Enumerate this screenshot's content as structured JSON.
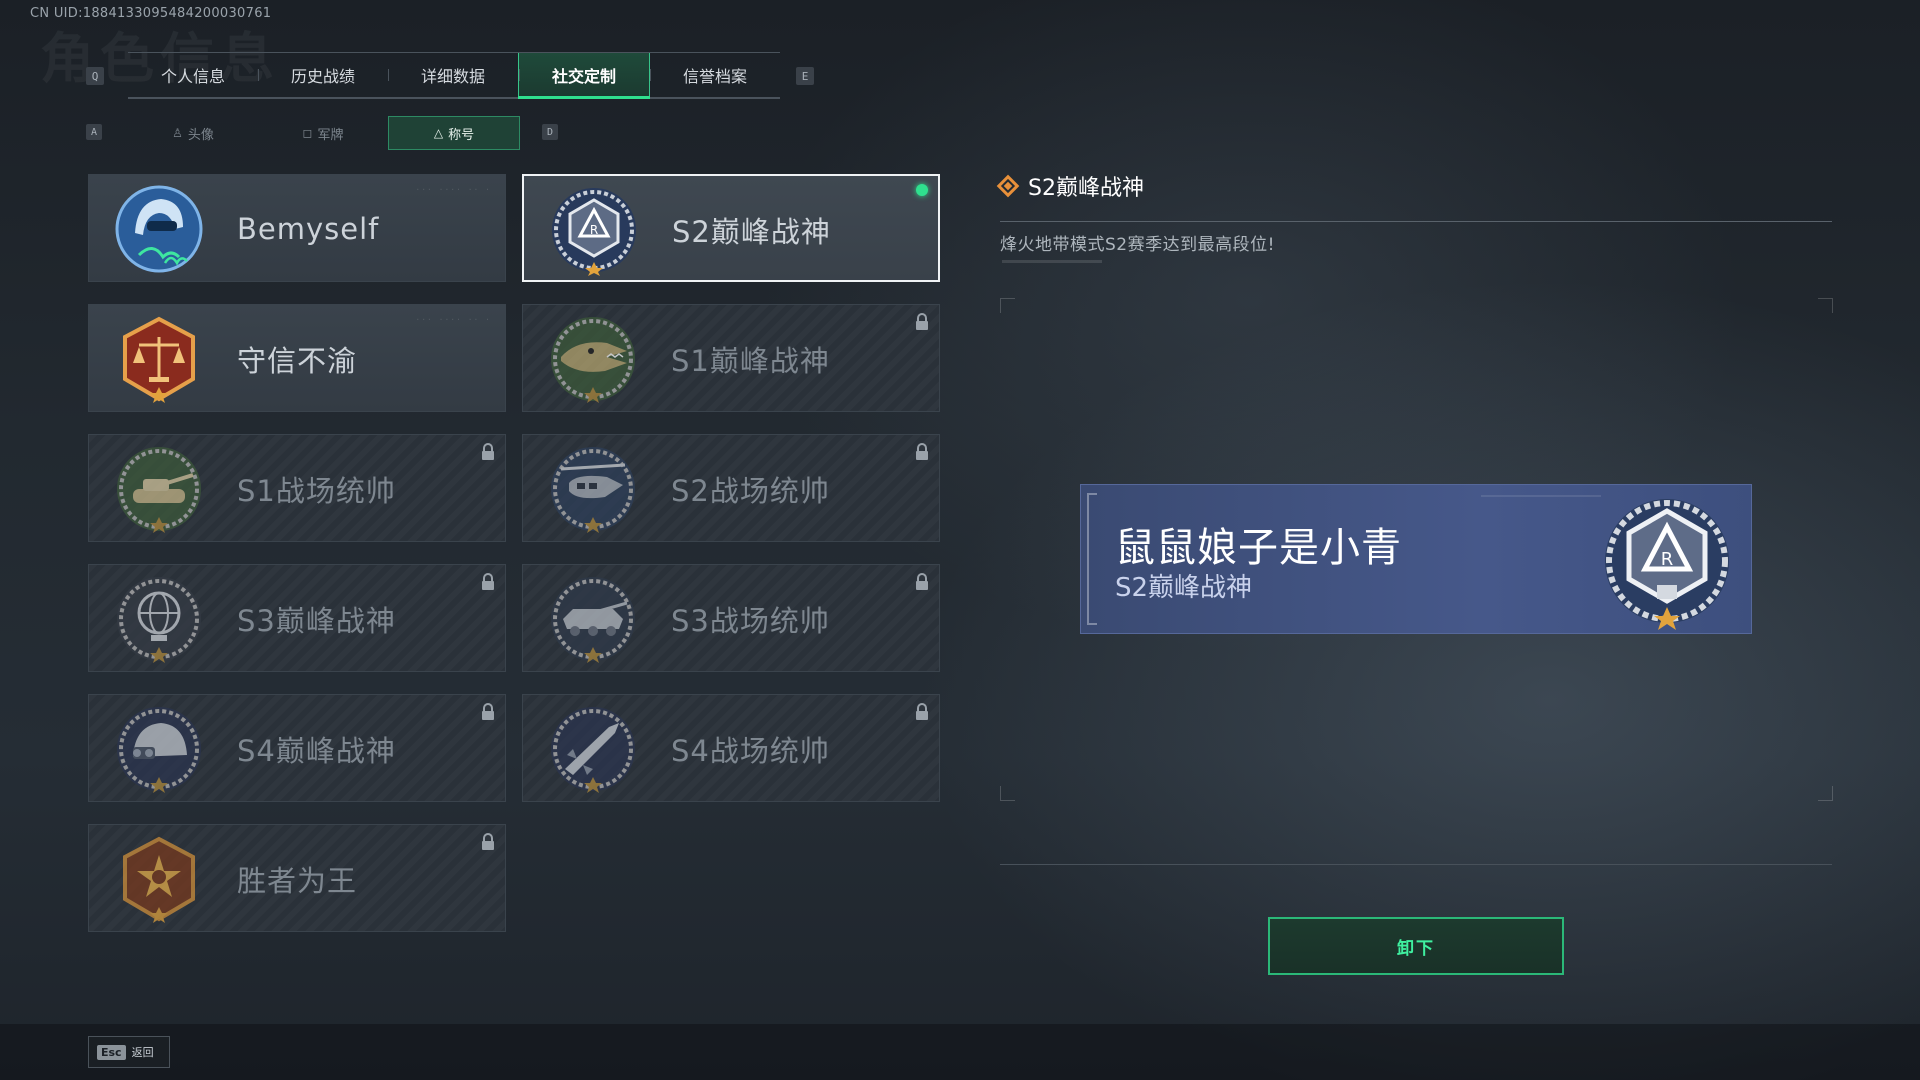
{
  "uid": "CN UID:1884133095484200030761",
  "ghost_title": "角色信息",
  "main_tabs": {
    "prev_key": "Q",
    "next_key": "E",
    "items": [
      {
        "label": "个人信息"
      },
      {
        "label": "历史战绩"
      },
      {
        "label": "详细数据"
      },
      {
        "label": "社交定制",
        "active": true
      },
      {
        "label": "信誉档案"
      }
    ]
  },
  "sub_tabs": {
    "prev_key": "A",
    "next_key": "D",
    "items": [
      {
        "label": "头像",
        "icon": "person-icon"
      },
      {
        "label": "军牌",
        "icon": "dogtag-icon"
      },
      {
        "label": "称号",
        "icon": "title-icon",
        "active": true
      }
    ]
  },
  "titles": [
    {
      "name": "Bemyself",
      "state": "unlocked",
      "badge": "helmet-signature-badge"
    },
    {
      "name": "S2巅峰战神",
      "state": "selected",
      "badge": "s2-peak-badge"
    },
    {
      "name": "守信不渝",
      "state": "unlocked",
      "badge": "scales-badge"
    },
    {
      "name": "S1巅峰战神",
      "state": "locked",
      "badge": "crocodile-badge"
    },
    {
      "name": "S1战场统帅",
      "state": "locked",
      "badge": "tank-badge"
    },
    {
      "name": "S2战场统帅",
      "state": "locked",
      "badge": "helicopter-badge"
    },
    {
      "name": "S3巅峰战神",
      "state": "locked",
      "badge": "globe-badge"
    },
    {
      "name": "S3战场统帅",
      "state": "locked",
      "badge": "armored-vehicle-badge"
    },
    {
      "name": "S4巅峰战神",
      "state": "locked",
      "badge": "nvg-helmet-badge"
    },
    {
      "name": "S4战场统帅",
      "state": "locked",
      "badge": "missile-badge"
    },
    {
      "name": "胜者为王",
      "state": "locked",
      "badge": "medal-badge"
    }
  ],
  "detail": {
    "title": "S2巅峰战神",
    "description": "烽火地带模式S2赛季达到最高段位!"
  },
  "preview": {
    "player_name": "鼠鼠娘子是小青",
    "title": "S2巅峰战神"
  },
  "actions": {
    "unequip_label": "卸下",
    "back_key": "Esc",
    "back_label": "返回"
  },
  "colors": {
    "accent_green": "#2fe08e",
    "preview_blue": "#46588a",
    "title_diamond_orange": "#e8903a"
  }
}
